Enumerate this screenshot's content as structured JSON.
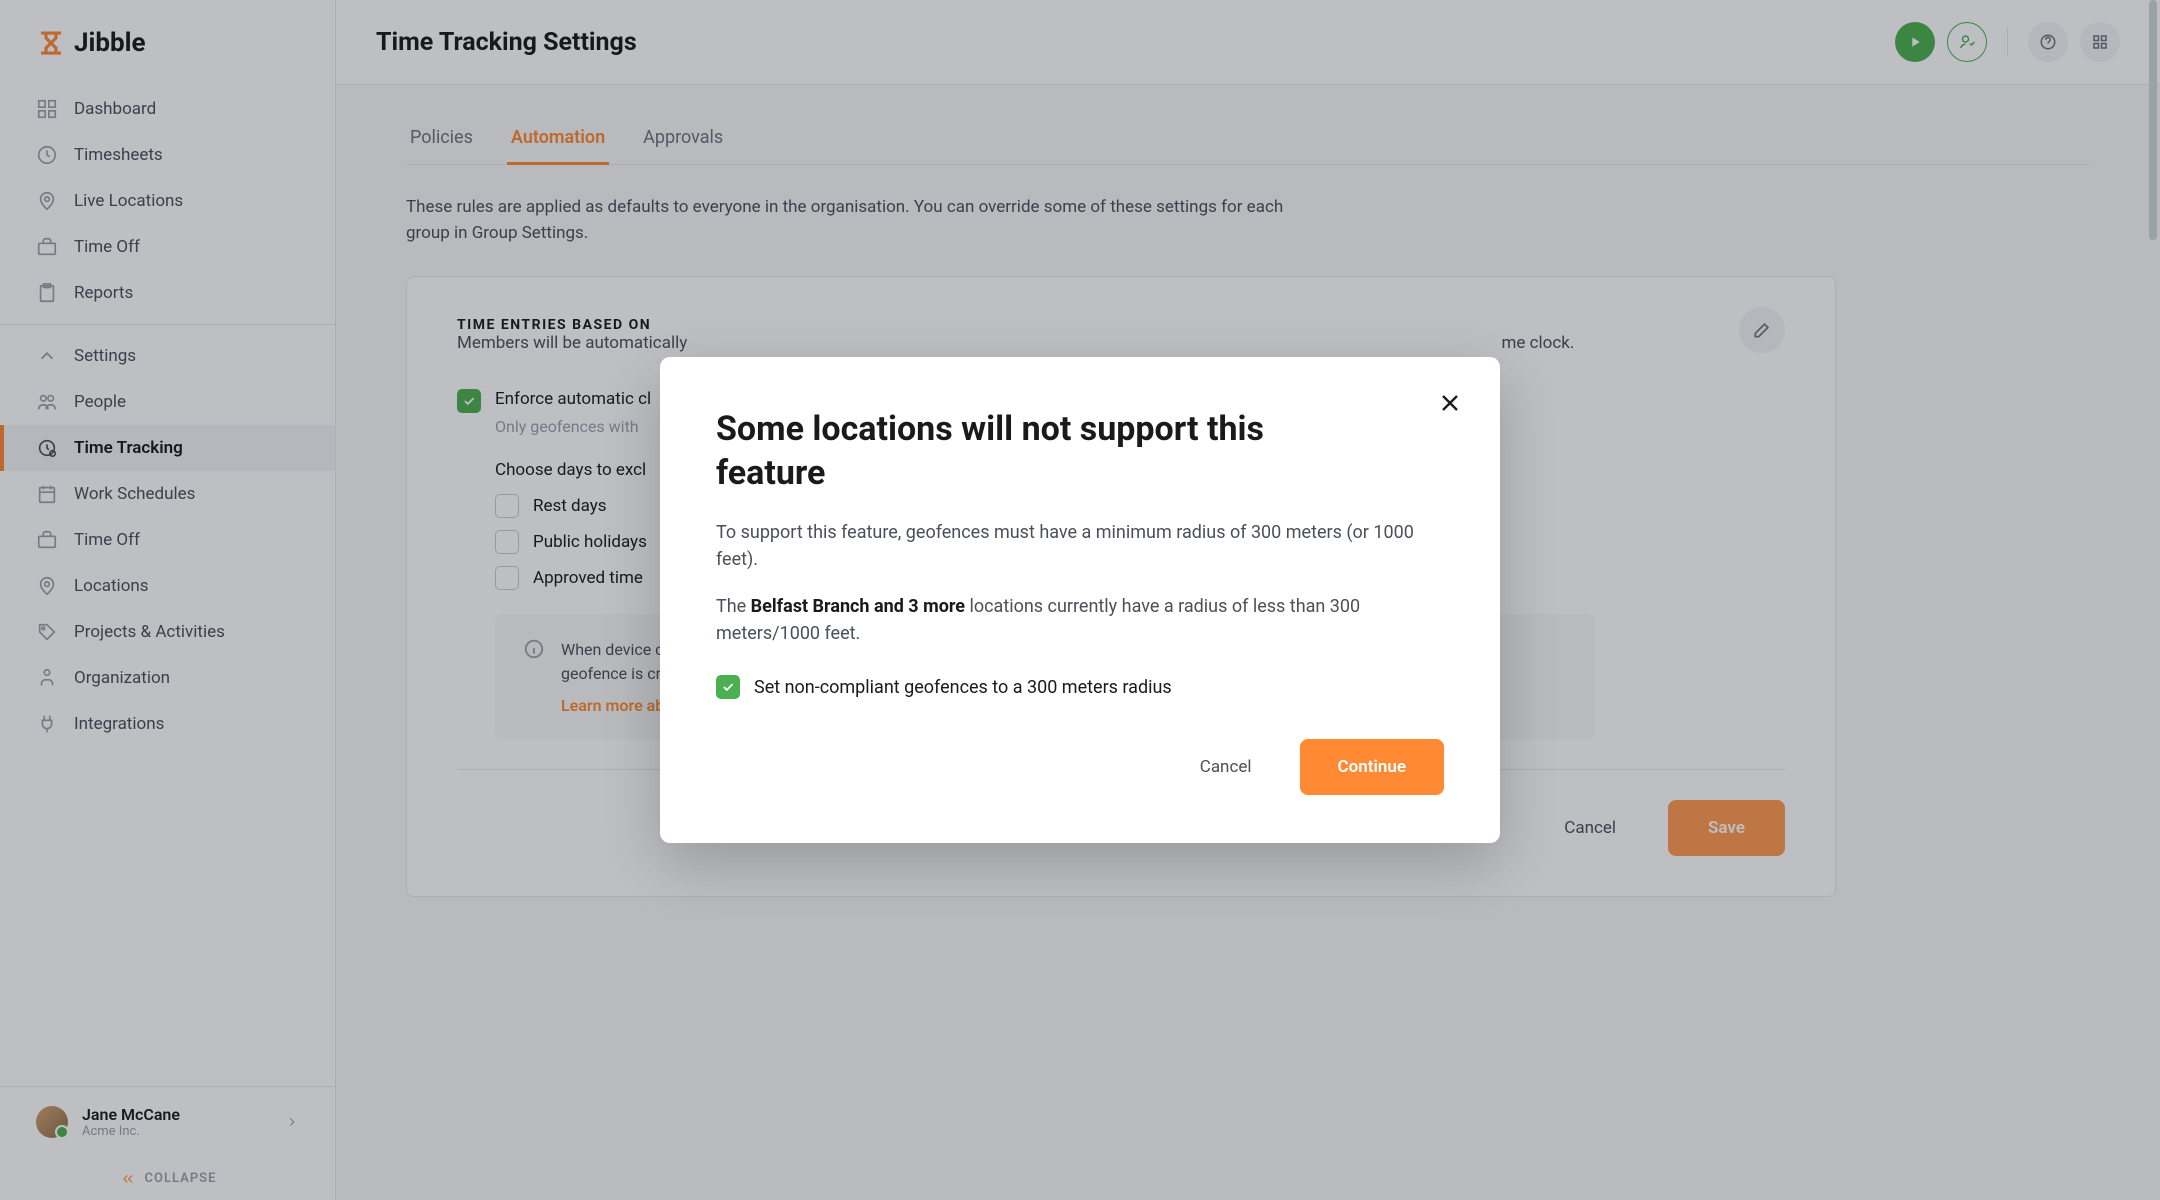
{
  "logo": {
    "text": "Jibble"
  },
  "sidebar": {
    "primary": [
      {
        "label": "Dashboard"
      },
      {
        "label": "Timesheets"
      },
      {
        "label": "Live Locations"
      },
      {
        "label": "Time Off"
      },
      {
        "label": "Reports"
      }
    ],
    "secondary": [
      {
        "label": "Settings"
      },
      {
        "label": "People"
      },
      {
        "label": "Time Tracking",
        "active": true
      },
      {
        "label": "Work Schedules"
      },
      {
        "label": "Time Off"
      },
      {
        "label": "Locations"
      },
      {
        "label": "Projects & Activities"
      },
      {
        "label": "Organization"
      },
      {
        "label": "Integrations"
      }
    ],
    "user": {
      "name": "Jane McCane",
      "org": "Acme Inc."
    },
    "collapse": "COLLAPSE"
  },
  "header": {
    "title": "Time Tracking Settings"
  },
  "tabs": [
    {
      "label": "Policies"
    },
    {
      "label": "Automation",
      "active": true
    },
    {
      "label": "Approvals"
    }
  ],
  "intro": "These rules are applied as defaults to everyone in the organisation. You can override some of these settings for each group in Group Settings.",
  "card": {
    "title": "TIME ENTRIES BASED ON",
    "desc_prefix": "Members will be automatically",
    "desc_suffix": "me clock.",
    "enforce_label": "Enforce automatic cl",
    "enforce_help": "Only geofences with",
    "choose_title": "Choose days to excl",
    "options": [
      {
        "label": "Rest days"
      },
      {
        "label": "Public holidays"
      },
      {
        "label": "Approved time"
      }
    ],
    "info_prefix": "When device com",
    "info_suffix": "geofence is crossed",
    "info_link": "Learn more about automation",
    "cancel": "Cancel",
    "save": "Save"
  },
  "modal": {
    "title": "Some locations will not support this feature",
    "p1": "To support this feature, geofences must have a minimum radius of 300 meters (or 1000 feet).",
    "p2_prefix": "The ",
    "p2_bold": "Belfast Branch and 3 more",
    "p2_suffix": " locations currently have a radius of less than 300 meters/1000 feet.",
    "checkbox_label": "Set non-compliant geofences to a 300 meters radius",
    "cancel": "Cancel",
    "continue": "Continue"
  }
}
